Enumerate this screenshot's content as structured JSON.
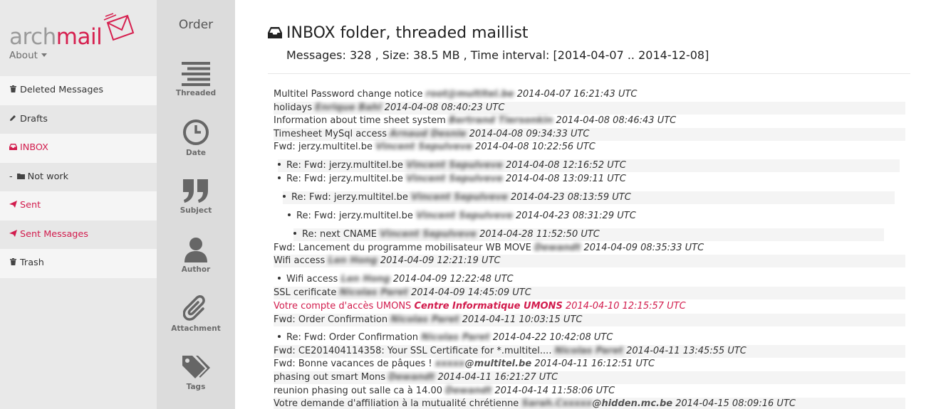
{
  "brand": {
    "name_part1": "arch",
    "name_part2": "mail",
    "about_label": "About"
  },
  "sidebar": {
    "items": [
      {
        "label": "Deleted Messages",
        "icon": "trash-icon"
      },
      {
        "label": "Drafts",
        "icon": "pencil-icon"
      },
      {
        "label": "INBOX",
        "icon": "inbox-icon",
        "active": true
      },
      {
        "label": "Not work",
        "icon": "folder-icon",
        "nested": true
      },
      {
        "label": "Sent",
        "icon": "send-icon"
      },
      {
        "label": "Sent Messages",
        "icon": "send-icon"
      },
      {
        "label": "Trash",
        "icon": "trash-icon"
      }
    ]
  },
  "order": {
    "title": "Order",
    "options": [
      {
        "label": "Threaded",
        "icon": "threaded-list-icon"
      },
      {
        "label": "Date",
        "icon": "clock-icon"
      },
      {
        "label": "Subject",
        "icon": "quote-icon"
      },
      {
        "label": "Author",
        "icon": "user-icon"
      },
      {
        "label": "Attachment",
        "icon": "paperclip-icon"
      },
      {
        "label": "Tags",
        "icon": "tags-icon"
      }
    ]
  },
  "main": {
    "title": "INBOX folder, threaded maillist",
    "subtitle": "Messages: 328 , Size: 38.5 MB , Time interval: [2014-04-07 .. 2014-12-08]"
  },
  "colors": {
    "accent": "#d21c4d",
    "sidebar_bg": "#e9e9e9",
    "order_bg": "#dcdcdc"
  },
  "messages": [
    {
      "subject": "Multitel Password change notice",
      "author": "root@multitel.be",
      "date": "2014-04-07 16:21:43 UTC",
      "level": 0
    },
    {
      "subject": "holidays",
      "author": "Enrique Bahl",
      "date": "2014-04-08 08:40:23 UTC",
      "level": 0
    },
    {
      "subject": "Information about time sheet system",
      "author": "Bertrand Tiersonkin",
      "date": "2014-04-08 08:46:43 UTC",
      "level": 0
    },
    {
      "subject": "Timesheet MySql access",
      "author": "Arnaud Desnie",
      "date": "2014-04-08 09:34:33 UTC",
      "level": 0
    },
    {
      "subject": "Fwd: jerzy.multitel.be",
      "author": "Vincent Sepulveve",
      "date": "2014-04-08 10:22:56 UTC",
      "level": 0
    },
    {
      "subject": "Re: Fwd: jerzy.multitel.be",
      "author": "Vincent Sepulveve",
      "date": "2014-04-08 12:16:52 UTC",
      "level": 1
    },
    {
      "subject": "Re: Fwd: jerzy.multitel.be",
      "author": "Vincent Sepulveve",
      "date": "2014-04-08 13:09:11 UTC",
      "level": 1
    },
    {
      "subject": "Re: Fwd: jerzy.multitel.be",
      "author": "Vincent Sepulveve",
      "date": "2014-04-23 08:13:59 UTC",
      "level": 2
    },
    {
      "subject": "Re: Fwd: jerzy.multitel.be",
      "author": "Vincent Sepulveve",
      "date": "2014-04-23 08:31:29 UTC",
      "level": 3
    },
    {
      "subject": "Re: next CNAME",
      "author": "Vincent Sepulveve",
      "date": "2014-04-28 11:52:50 UTC",
      "level": 4
    },
    {
      "subject": "Fwd: Lancement du programme mobilisateur WB MOVE",
      "author": "Dewandt",
      "date": "2014-04-09 08:35:33 UTC",
      "level": 0
    },
    {
      "subject": "Wifi access",
      "author": "Len Hong",
      "date": "2014-04-09 12:21:19 UTC",
      "level": 0
    },
    {
      "subject": "Wifi access",
      "author": "Len Hong",
      "date": "2014-04-09 12:22:48 UTC",
      "level": 1
    },
    {
      "subject": "SSL cerificate",
      "author": "Nicolas Paret",
      "date": "2014-04-09 14:45:09 UTC",
      "level": 0
    },
    {
      "subject": "Votre compte d'accès UMONS",
      "author": "Centre Informatique UMONS",
      "date": "2014-04-10 12:15:57 UTC",
      "level": 0,
      "highlight": true
    },
    {
      "subject": "Fwd: Order Confirmation",
      "author": "Nicolas Paret",
      "date": "2014-04-11 10:03:15 UTC",
      "level": 0
    },
    {
      "subject": "Re: Fwd: Order Confirmation",
      "author": "Nicolas Paret",
      "date": "2014-04-22 10:42:08 UTC",
      "level": 1
    },
    {
      "subject": "Fwd: CE201404114358: Your SSL Certificate for *.multitel....",
      "author": "Nicolas Paret",
      "date": "2014-04-11 13:45:55 UTC",
      "level": 0
    },
    {
      "subject": "Fwd: Bonne vacances de pâques !",
      "author": "xxxxx@multitel.be",
      "date": "2014-04-11 16:12:51 UTC",
      "level": 0,
      "partial": "@multitel.be"
    },
    {
      "subject": "phasing out smart Mons",
      "author": "Dewandt",
      "date": "2014-04-11 16:21:27 UTC",
      "level": 0
    },
    {
      "subject": "reunion phasing out salle ca à 14.00",
      "author": "Dewandt",
      "date": "2014-04-14 11:58:06 UTC",
      "level": 0
    },
    {
      "subject": "Votre demande d'affiliation à la mutualité chrétienne",
      "author": "Sarah.Cxxxxx@hidden.mc.be",
      "date": "2014-04-15 08:09:16 UTC",
      "level": 0,
      "partial": "@hidden.mc.be"
    }
  ]
}
